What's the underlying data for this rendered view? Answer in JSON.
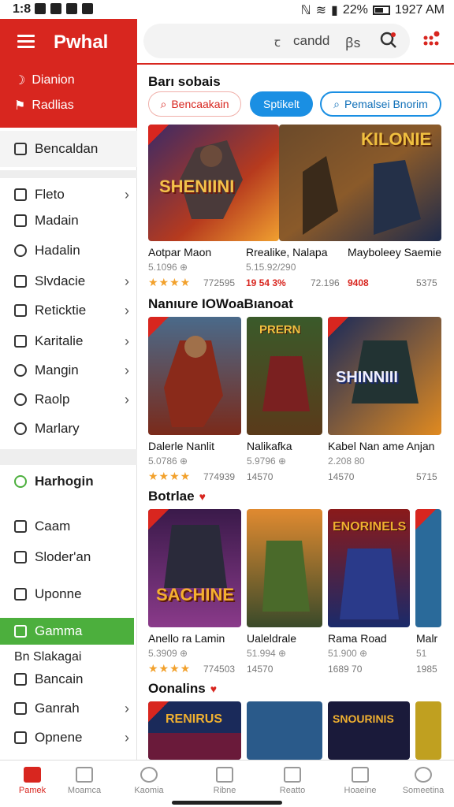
{
  "status": {
    "time": "1:8",
    "signal": "ℕ",
    "battery": "22%",
    "clock": "1927 AM"
  },
  "sidebar": {
    "brand": "Pwhal",
    "head_items": [
      {
        "label": "Dianion"
      },
      {
        "label": "Radlias"
      }
    ],
    "section1": "Bencaldan",
    "items": [
      {
        "label": "Fleto",
        "chev": "›"
      },
      {
        "label": "Madain",
        "chev": ""
      },
      {
        "label": "Hadalin",
        "chev": ""
      },
      {
        "label": "Slvdacie",
        "chev": "›"
      },
      {
        "label": "Reticktie",
        "chev": "›"
      },
      {
        "label": "Karitalie",
        "chev": "›"
      },
      {
        "label": "Mangin",
        "chev": "›"
      },
      {
        "label": "Raolp",
        "chev": "›"
      },
      {
        "label": "Marlary",
        "chev": ""
      }
    ],
    "section2": "Harhogin",
    "items2": [
      {
        "label": "Caam"
      },
      {
        "label": "Sloder'an"
      },
      {
        "label": "Uponne"
      }
    ],
    "active": "Gamma",
    "plain": "Bn Slakagai",
    "items3": [
      {
        "label": "Bancain",
        "chev": ""
      },
      {
        "label": "Ganrah",
        "chev": "›"
      },
      {
        "label": "Opnene",
        "chev": "›"
      }
    ]
  },
  "search": {
    "placeholder": "candd",
    "query_suffix": "ꞵs",
    "clear": "ꞇ"
  },
  "sections": [
    {
      "title": "Barı sobais"
    },
    {
      "title": "Nanıure IOWoaBıanoat"
    },
    {
      "title": "Botrlae",
      "heart": "♥"
    },
    {
      "title": "Oonalins",
      "heart": "♥"
    }
  ],
  "chips": [
    "Bencaakain",
    "Sptikelt",
    "Pemalsei Bnorim"
  ],
  "row1": [
    {
      "name": "Aotpar Maon",
      "sub": "5.1096 ⊕",
      "rating": "★★★★",
      "count": "772595",
      "art": "SHENIINI"
    },
    {
      "name": "Rrealike, Nalapa",
      "sub": "5.15.92/290",
      "price": "19 54 3%",
      "count": "72.196",
      "art": ""
    },
    {
      "name": "Mayboleey Saemie",
      "sub": "",
      "price": "9408",
      "count": "5375",
      "art": "KILONIE"
    }
  ],
  "row2": [
    {
      "name": "Dalerle Nanlit",
      "sub": "5.0786 ⊕",
      "rating": "★★★★",
      "count": "774939",
      "art": ""
    },
    {
      "name": "Nalikafka",
      "sub": "5.9796 ⊕",
      "count": "14570",
      "art": "PRERN"
    },
    {
      "name": "Kabel Nan ame Anjan",
      "sub": "2.208 80",
      "count": "14570",
      "extra": "5715",
      "art": "SHINNIII"
    }
  ],
  "row3": [
    {
      "name": "Anello ra Lamin",
      "sub": "5.3909 ⊕",
      "rating": "★★★★",
      "count": "774503",
      "art": "SACHINE"
    },
    {
      "name": "Ualeldrale",
      "sub": "51.994 ⊕",
      "count": "14570",
      "art": ""
    },
    {
      "name": "Rama Road",
      "sub": "51.900 ⊕",
      "count": "1689 70",
      "art": "ENORINELS"
    },
    {
      "name": "Malr",
      "sub": "51",
      "count": "1985",
      "art": ""
    }
  ],
  "row4": [
    {
      "art": "RENIRUS"
    },
    {
      "art": ""
    },
    {
      "art": "SNOURINIS"
    },
    {
      "art": ""
    }
  ],
  "bottom_nav": [
    {
      "label": "Pamek",
      "active": true
    },
    {
      "label": "Moamca"
    },
    {
      "label": "Kaomia"
    },
    {
      "label": "Ribne"
    },
    {
      "label": "Reatto"
    },
    {
      "label": "Hoaeine"
    },
    {
      "label": "Someetina"
    }
  ],
  "colors": {
    "brand_red": "#d8261f",
    "accent_blue": "#1a8fe3",
    "active_green": "#4caf3d",
    "star": "#f2a12c"
  }
}
